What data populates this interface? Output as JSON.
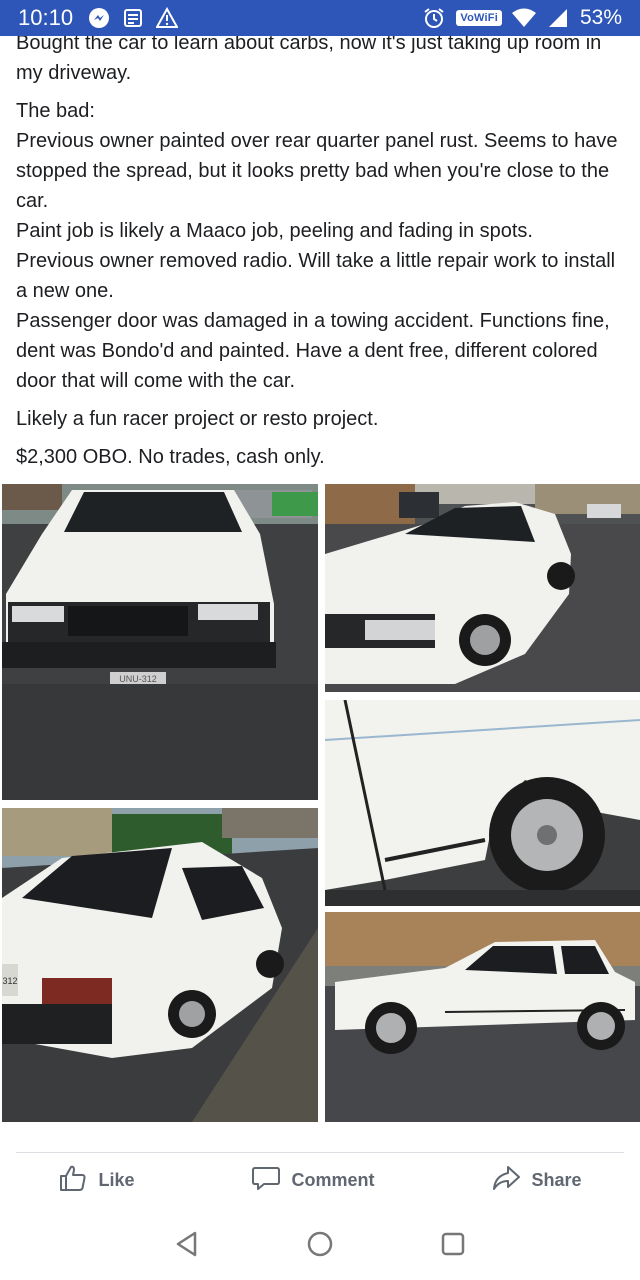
{
  "status_bar": {
    "time": "10:10",
    "wifi_badge": "VoWiFi",
    "battery": "53%",
    "icons": [
      "messenger-icon",
      "news-icon",
      "warning-icon",
      "alarm-icon",
      "wifi-icon",
      "signal-icon"
    ]
  },
  "post": {
    "paragraphs": [
      "Bought the car to learn about carbs, now it's just taking up room in my driveway.",
      "The bad:",
      "Previous owner painted over rear quarter panel rust. Seems to have stopped the spread, but it looks pretty bad when you're close to the car.",
      "Paint job is likely a Maaco job, peeling and fading in spots.",
      "Previous owner removed radio. Will take a little repair work to install a new one.",
      "Passenger door was damaged in a towing accident. Functions fine, dent was Bondo'd and painted. Have a dent free, different colored door that will come with the car.",
      "Likely a fun racer project or resto project.",
      "$2,300 OBO. No trades, cash only."
    ]
  },
  "photos": [
    {
      "name": "photo-front",
      "plate": "UNU-312"
    },
    {
      "name": "photo-front-left-three-quarter"
    },
    {
      "name": "photo-door-wheel-closeup"
    },
    {
      "name": "photo-rear-three-quarter",
      "plate": "312"
    },
    {
      "name": "photo-side-profile"
    }
  ],
  "actions": {
    "like": "Like",
    "comment": "Comment",
    "share": "Share"
  },
  "colors": {
    "status_bar": "#2d56b8",
    "text": "#1c1e21",
    "action_text": "#606770",
    "car_white": "#f2f2ef"
  }
}
